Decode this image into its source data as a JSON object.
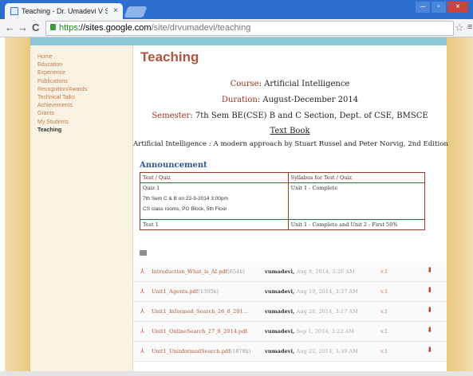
{
  "browser": {
    "tab_title": "Teaching - Dr. Umadevi V Sr",
    "tab_close": "×",
    "nav_back": "←",
    "nav_forward": "→",
    "nav_reload": "C",
    "url_proto": "https",
    "url_host": "://sites.google.com",
    "url_path": "/site/drvumadevi/teaching",
    "star": "☆",
    "menu": "≡",
    "win_min": "–",
    "win_max": "▫",
    "win_close": "×"
  },
  "sidebar": {
    "items": [
      {
        "label": "Home"
      },
      {
        "label": "Education"
      },
      {
        "label": "Experience"
      },
      {
        "label": "Publications"
      },
      {
        "label": "Recognition/Awards"
      },
      {
        "label": "Technical Talks"
      },
      {
        "label": "Achievements"
      },
      {
        "label": "Grants"
      },
      {
        "label": "My Students"
      },
      {
        "label": "Teaching"
      }
    ]
  },
  "main": {
    "title": "Teaching",
    "course_label": "Course",
    "course_value": ": Artificial Intelligence",
    "duration_label": "Duration",
    "duration_value": ": August-December 2014",
    "semester_label": "Semester",
    "semester_value": ":  7th Sem BE(CSE) B and C Section, Dept. of CSE, BMSCE",
    "textbook_label": "Text Book",
    "textbook_desc": "Artificial Intelligence : A modern approach by Stuart Russel and Peter Norvig, 2nd Edition",
    "announcement": "Announcement"
  },
  "table": {
    "header_left": "Test / Quiz",
    "header_right": "Syllabus for Test / Quiz",
    "r1_left_1": "Quiz 1",
    "r1_left_2": "7th Sem C & B on 22-9-2014 3:00pm",
    "r1_left_3": "CS class rooms, PG Block, 5th Floor",
    "r1_right": "Unit 1 - Complete",
    "r2_left": "Test 1",
    "r2_right": "Unit 1 - Complete and Unit 2 - First 50%"
  },
  "files": [
    {
      "name": "Introduction_What_is_AI.pdf",
      "size": "(654k)",
      "owner": "vumadevi,",
      "date": "Aug 8, 2014, 3:26 AM",
      "version": "v.1"
    },
    {
      "name": "Unit1_Agents.pdf",
      "size": "(1395k)",
      "owner": "vumadevi,",
      "date": "Aug 19, 2014, 3:37 AM",
      "version": "v.1"
    },
    {
      "name": "Unit1_Informed_Search_26_8_201...",
      "size": "",
      "owner": "vumadevi,",
      "date": "Aug 28, 2014, 3:17 AM",
      "version": "v.1"
    },
    {
      "name": "Unit1_OnlineSearch_27_8_2014.pdf",
      "size": "",
      "owner": "vumadevi,",
      "date": "Sep 1, 2014, 3:22 AM",
      "version": "v.1"
    },
    {
      "name": "Unit1_UninformedSearch.pdf",
      "size": "(1878k)",
      "owner": "vumadevi,",
      "date": "Aug 22, 2014, 3:39 AM",
      "version": "v.1"
    }
  ]
}
